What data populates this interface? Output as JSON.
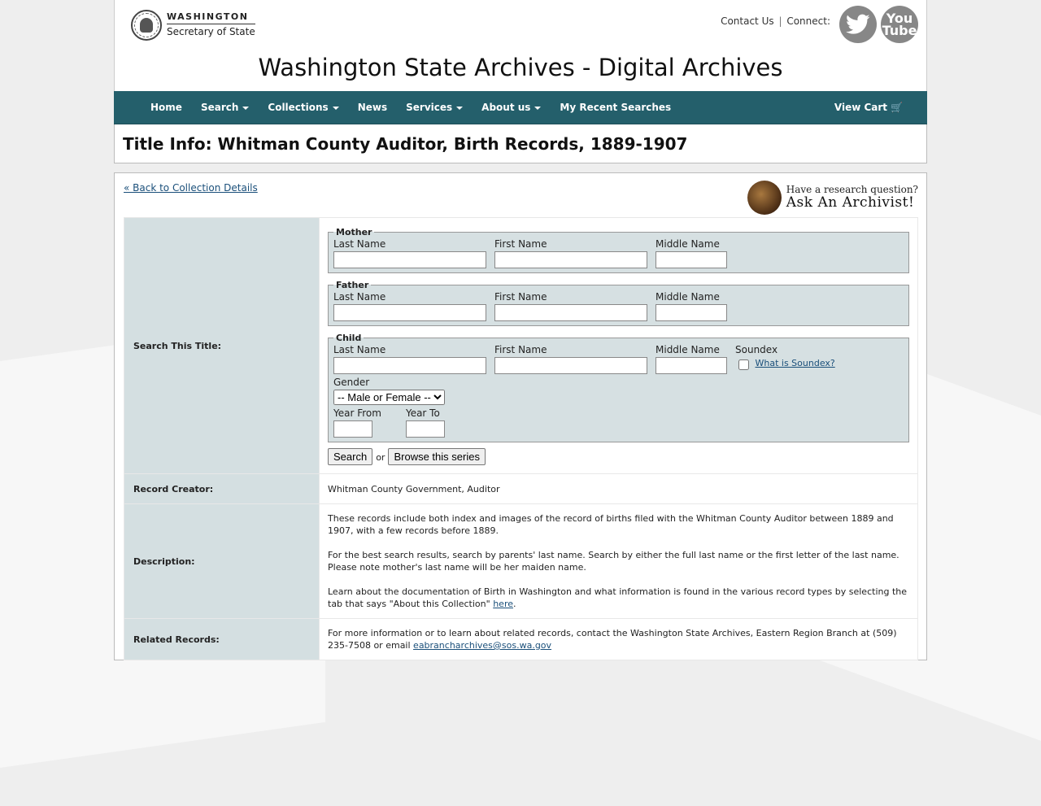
{
  "header": {
    "logo_top": "WASHINGTON",
    "logo_bottom": "Secretary of State",
    "contact_us": "Contact Us",
    "separator": "|",
    "connect": "Connect:",
    "youtube_label": "You Tube",
    "site_title": "Washington State Archives - Digital Archives"
  },
  "nav": {
    "items": [
      {
        "label": "Home",
        "dropdown": false
      },
      {
        "label": "Search",
        "dropdown": true
      },
      {
        "label": "Collections",
        "dropdown": true
      },
      {
        "label": "News",
        "dropdown": false
      },
      {
        "label": "Services",
        "dropdown": true
      },
      {
        "label": "About us",
        "dropdown": true
      },
      {
        "label": "My Recent Searches",
        "dropdown": false
      }
    ],
    "cart": "View Cart",
    "cart_icon": "🛒"
  },
  "title": "Title Info: Whitman County Auditor, Birth Records, 1889-1907",
  "content": {
    "back_link": "« Back to Collection Details",
    "ask_small": "Have a research question?",
    "ask_big": "Ask An Archivist!",
    "search_label": "Search This Title:",
    "mother": {
      "legend": "Mother",
      "last": "Last Name",
      "first": "First Name",
      "middle": "Middle Name"
    },
    "father": {
      "legend": "Father",
      "last": "Last Name",
      "first": "First Name",
      "middle": "Middle Name"
    },
    "child": {
      "legend": "Child",
      "last": "Last Name",
      "first": "First Name",
      "middle": "Middle Name",
      "soundex": "Soundex",
      "soundex_link": "What is Soundex?",
      "gender": "Gender",
      "gender_selected": "-- Male or Female --",
      "year_from": "Year From",
      "year_to": "Year To"
    },
    "search_button": "Search",
    "or": "or",
    "browse_button": "Browse this series",
    "record_creator_label": "Record Creator:",
    "record_creator_value": "Whitman County Government, Auditor",
    "description_label": "Description:",
    "description_p1": "These records include both index and images of the record of births filed with the Whitman County Auditor between 1889 and 1907, with a few records before 1889.",
    "description_p2": "For the best search results, search by parents' last name. Search by either the full last name or the first letter of the last name. Please note mother's last name will be her maiden name.",
    "description_p3": "Learn about the documentation of Birth in Washington and what information is found in the various record types by selecting the tab that says \"About this Collection\"",
    "description_here": "here",
    "description_end": ".",
    "related_label": "Related Records:",
    "related_text": "For more information or to learn about related records, contact the Washington State Archives, Eastern Region Branch at (509) 235-7508 or email",
    "related_email": "eabrancharchives@sos.wa.gov"
  }
}
